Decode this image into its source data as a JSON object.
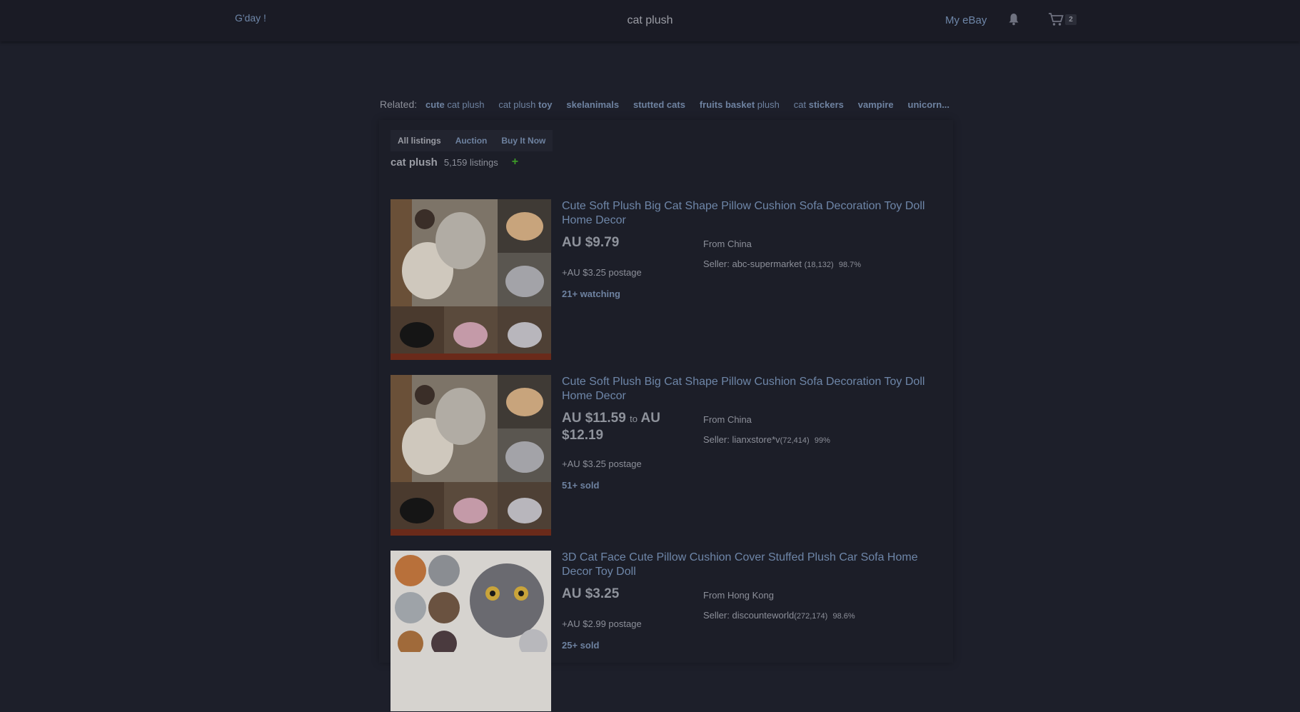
{
  "header": {
    "greeting": "G'day !",
    "search_term": "cat plush",
    "my_ebay": "My eBay",
    "cart_count": "2"
  },
  "related": {
    "label": "Related:",
    "chips": [
      {
        "bold": "cute",
        "plain": " cat plush"
      },
      {
        "plain": "cat plush ",
        "bold": "toy"
      },
      {
        "bold": "skelanimals",
        "plain": ""
      },
      {
        "bold": "stutted cats",
        "plain": ""
      },
      {
        "bold": "fruits basket",
        "plain": " plush"
      },
      {
        "plain": "cat ",
        "bold": "stickers"
      },
      {
        "bold": "vampire",
        "plain": ""
      },
      {
        "bold": "unicorn...",
        "plain": ""
      }
    ]
  },
  "filters": {
    "tabs": [
      "All listings",
      "Auction",
      "Buy It Now"
    ],
    "active": "All listings"
  },
  "results": {
    "query": "cat plush",
    "count": "5,159 listings",
    "add_icon": "plus-icon"
  },
  "listings": [
    {
      "title": "Cute Soft Plush Big Cat Shape Pillow Cushion Sofa Decoration Toy Doll Home Decor",
      "price": "AU $9.79",
      "price_to": "",
      "price_high": "",
      "postage": "+AU $3.25 postage",
      "hotness": "21+ watching",
      "from": "From China",
      "seller_prefix": "Seller: ",
      "seller_name": "abc-supermarket",
      "seller_score": "(18,132)",
      "seller_pct": "98.7%"
    },
    {
      "title": "Cute Soft Plush Big Cat Shape Pillow Cushion Sofa Decoration Toy Doll Home Decor",
      "price": "AU $11.59",
      "price_to": "to",
      "price_high": "AU $12.19",
      "postage": "+AU $3.25 postage",
      "hotness": "51+ sold",
      "from": "From China",
      "seller_prefix": "Seller: ",
      "seller_name": "lianxstore*v",
      "seller_score": "(72,414)",
      "seller_pct": "99%"
    },
    {
      "title": "3D Cat Face Cute Pillow Cushion Cover Stuffed Plush Car Sofa Home Decor Toy Doll",
      "price": "AU $3.25",
      "price_to": "",
      "price_high": "",
      "postage": "+AU $2.99 postage",
      "hotness": "25+ sold",
      "from": "From Hong Kong",
      "seller_prefix": "Seller: ",
      "seller_name": "discounteworld",
      "seller_score": "(272,174)",
      "seller_pct": "98.6%"
    }
  ],
  "colors": {
    "background": "#1d1f2a",
    "link": "#6e86a8",
    "text": "#8c8f99",
    "accent_green": "#3c9a27"
  }
}
